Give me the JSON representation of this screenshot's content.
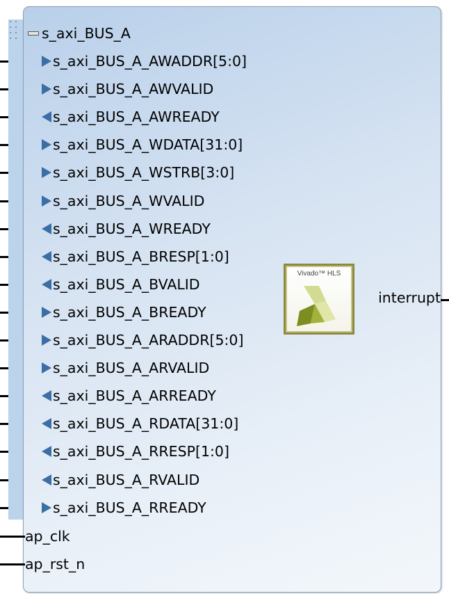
{
  "block": {
    "bus_name": "s_axi_BUS_A",
    "logo_text": "Vivado™ HLS",
    "bus_ports": [
      {
        "name": "s_axi_BUS_A_AWADDR[5:0]",
        "dir": "in"
      },
      {
        "name": "s_axi_BUS_A_AWVALID",
        "dir": "in"
      },
      {
        "name": "s_axi_BUS_A_AWREADY",
        "dir": "out"
      },
      {
        "name": "s_axi_BUS_A_WDATA[31:0]",
        "dir": "in"
      },
      {
        "name": "s_axi_BUS_A_WSTRB[3:0]",
        "dir": "in"
      },
      {
        "name": "s_axi_BUS_A_WVALID",
        "dir": "in"
      },
      {
        "name": "s_axi_BUS_A_WREADY",
        "dir": "out"
      },
      {
        "name": "s_axi_BUS_A_BRESP[1:0]",
        "dir": "out"
      },
      {
        "name": "s_axi_BUS_A_BVALID",
        "dir": "out"
      },
      {
        "name": "s_axi_BUS_A_BREADY",
        "dir": "in"
      },
      {
        "name": "s_axi_BUS_A_ARADDR[5:0]",
        "dir": "in"
      },
      {
        "name": "s_axi_BUS_A_ARVALID",
        "dir": "in"
      },
      {
        "name": "s_axi_BUS_A_ARREADY",
        "dir": "out"
      },
      {
        "name": "s_axi_BUS_A_RDATA[31:0]",
        "dir": "out"
      },
      {
        "name": "s_axi_BUS_A_RRESP[1:0]",
        "dir": "out"
      },
      {
        "name": "s_axi_BUS_A_RVALID",
        "dir": "out"
      },
      {
        "name": "s_axi_BUS_A_RREADY",
        "dir": "in"
      }
    ],
    "scalar_ports": [
      {
        "name": "ap_clk"
      },
      {
        "name": "ap_rst_n"
      }
    ],
    "output_ports": [
      {
        "name": "interrupt"
      }
    ]
  },
  "colors": {
    "arrow": "#3a6ea5",
    "logo_border": "#8c8a3c",
    "logo_green_dark": "#7a8a1e",
    "logo_green_light": "#cfd98a"
  },
  "icons": {
    "bus_toggle": "collapse-bus-icon",
    "logo": "vivado-hls-logo-icon"
  }
}
